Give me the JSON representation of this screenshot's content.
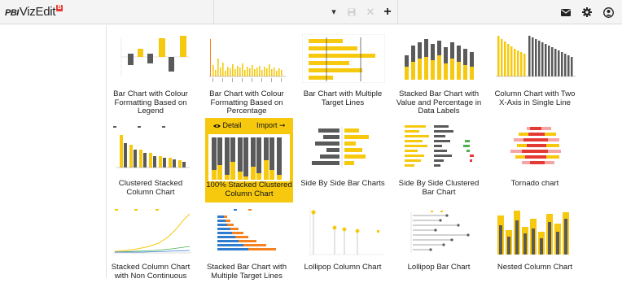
{
  "app": {
    "logo_prefix": "PBI",
    "logo_name": "VizEdit",
    "logo_badge": "B"
  },
  "toolbar": {
    "dropdown_icon": "caret-down-icon",
    "save_icon": "save-icon",
    "close_icon": "close-icon",
    "add_icon": "plus-icon",
    "caret_glyph": "▾",
    "close_glyph": "✕",
    "add_glyph": "+"
  },
  "header_icons": [
    "envelope-icon",
    "gear-icon",
    "user-circle-icon"
  ],
  "colors": {
    "accent": "#f6c90e",
    "dark": "#5a5a5a",
    "orange": "#f58220",
    "blue": "#2e7bcf",
    "red": "#e53935"
  },
  "hover_card": {
    "detail_label": "Detail",
    "import_label": "Import"
  },
  "cards": [
    {
      "title": "Bar Chart with Colour Formatting Based on Legend"
    },
    {
      "title": "Bar Chart with Colour Formatting Based on Percentage"
    },
    {
      "title": "Bar Chart with Multiple Target Lines"
    },
    {
      "title": "Stacked Bar Chart with Value and Percentage in Data Labels"
    },
    {
      "title": "Column Chart with Two X-Axis in Single Line"
    },
    {
      "title": "Clustered Stacked Column Chart"
    },
    {
      "title": "100% Stacked Clustered Column Chart"
    },
    {
      "title": "Side By Side Bar Charts"
    },
    {
      "title": "Side By Side Clustered Bar Chart"
    },
    {
      "title": "Tornado chart"
    },
    {
      "title": "Stacked Column Chart with Non Continuous"
    },
    {
      "title": "Stacked Bar Chart with Multiple Target Lines"
    },
    {
      "title": "Lollipop Column Chart"
    },
    {
      "title": "Lollipop Bar Chart"
    },
    {
      "title": "Nested Column Chart"
    }
  ]
}
